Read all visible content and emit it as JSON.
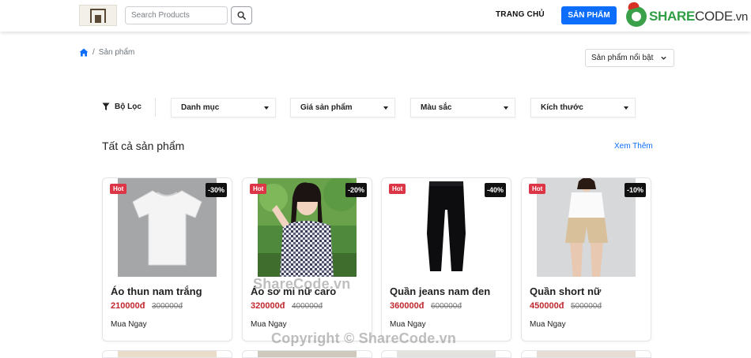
{
  "header": {
    "search_placeholder": "Search Products",
    "nav_home": "TRANG CHỦ",
    "nav_products": "SẢN PHẨM",
    "brand_main": "SHARE",
    "brand_code": "CODE",
    "brand_tld": ".vn"
  },
  "breadcrumb": {
    "separator": "/",
    "current": "Sản phẩm"
  },
  "sort": {
    "selected": "Sản phẩm nổi bật"
  },
  "filters": {
    "label": "Bộ Lọc",
    "dropdowns": [
      "Danh mục",
      "Giá sản phẩm",
      "Màu sắc",
      "Kích thước"
    ]
  },
  "section": {
    "title": "Tất cả sản phẩm",
    "see_more": "Xem Thêm"
  },
  "products": [
    {
      "badge": "Hot",
      "discount": "-30%",
      "name": "Áo thun nam trắng",
      "price": "210000đ",
      "old_price": "300000đ",
      "buy": "Mua Ngay"
    },
    {
      "badge": "Hot",
      "discount": "-20%",
      "name": "Áo sơ mi nữ caro",
      "price": "320000đ",
      "old_price": "400000đ",
      "buy": "Mua Ngay"
    },
    {
      "badge": "Hot",
      "discount": "-40%",
      "name": "Quần jeans nam đen",
      "price": "360000đ",
      "old_price": "600000đ",
      "buy": "Mua Ngay"
    },
    {
      "badge": "Hot",
      "discount": "-10%",
      "name": "Quần short nữ",
      "price": "450000đ",
      "old_price": "500000đ",
      "buy": "Mua Ngay"
    }
  ],
  "watermarks": {
    "top": "ShareCode.vn",
    "bottom": "Copyright © ShareCode.vn"
  },
  "colors": {
    "primary": "#0d6efd",
    "hot": "#dc3545",
    "price": "#c0272d",
    "brand_green": "#2f9e44"
  }
}
